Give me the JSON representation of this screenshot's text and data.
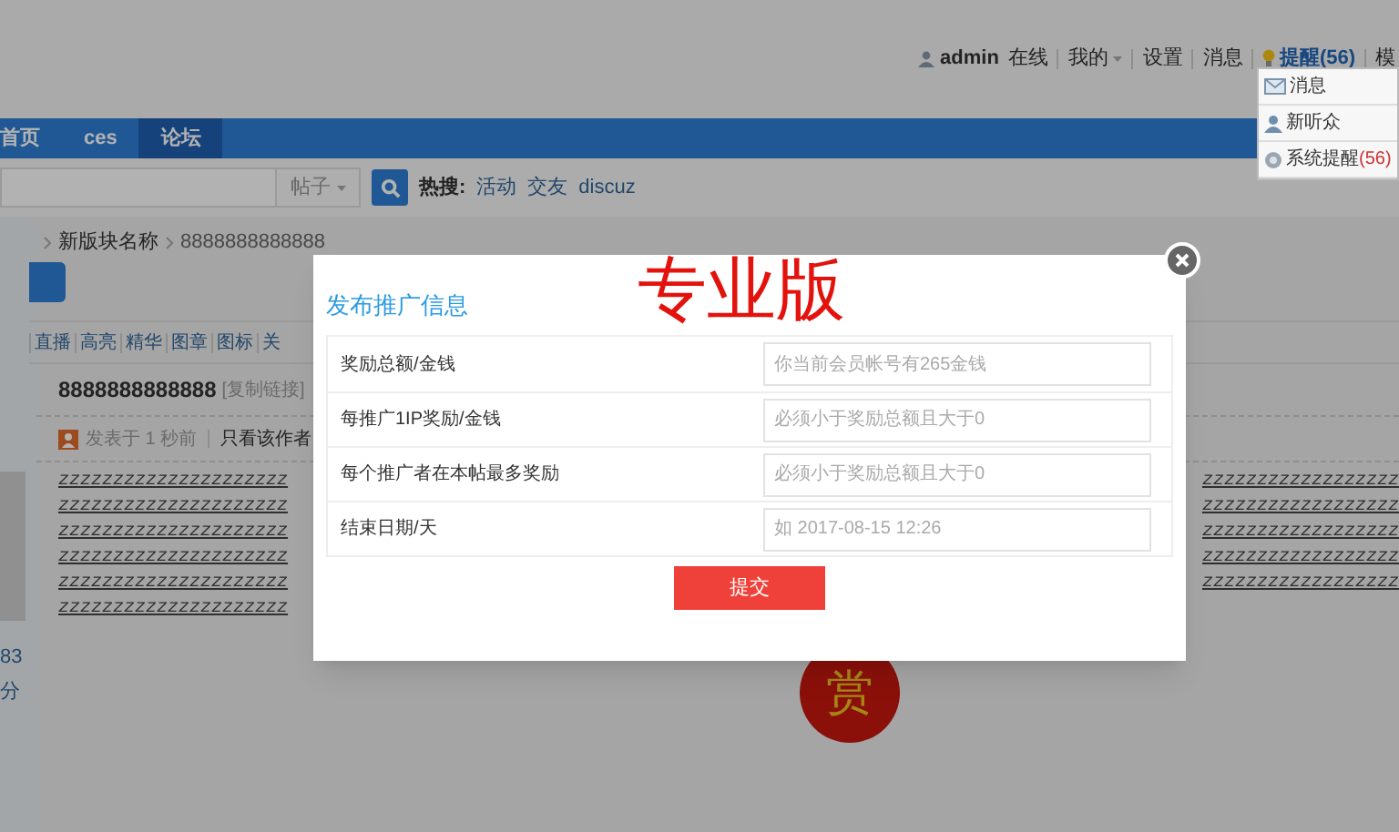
{
  "user_bar": {
    "username": "admin",
    "status": "在线",
    "links": [
      {
        "label": "我的",
        "kind": "menu"
      },
      {
        "label": "设置",
        "kind": "plain"
      },
      {
        "label": "消息",
        "kind": "plain"
      },
      {
        "label": "提醒(56)",
        "kind": "alert"
      },
      {
        "label": "模",
        "kind": "plain"
      }
    ]
  },
  "notify_menu": [
    {
      "label": "消息",
      "kind": "mail"
    },
    {
      "label": "新听众",
      "kind": "user"
    },
    {
      "label": "系统提醒",
      "count": "(56)",
      "kind": "system"
    }
  ],
  "nav": [
    {
      "label": "首页",
      "selected": false
    },
    {
      "label": "ces",
      "selected": false
    },
    {
      "label": "论坛",
      "selected": true
    }
  ],
  "search": {
    "scope": "帖子",
    "hot_label": "热搜:",
    "hot": [
      "活动",
      "交友",
      "discuz"
    ]
  },
  "breadcrumb": [
    "新版块名称",
    "8888888888888"
  ],
  "filters": [
    "直播",
    "高亮",
    "精华",
    "图章",
    "图标",
    "关"
  ],
  "post": {
    "title": "8888888888888",
    "copy_link": "[复制链接]",
    "meta": "发表于 1 秒前",
    "author_only": "只看该作者",
    "author_stats": [
      "83",
      "分"
    ],
    "reward": "赏",
    "lines_left": [
      "zzzzzzzzzzzzzzzzzzzzz",
      "zzzzzzzzzzzzzzzzzzzzz",
      "zzzzzzzzzzzzzzzzzzzzz",
      "zzzzzzzzzzzzzzzzzzzzz",
      "zzzzzzzzzzzzzzzzzzzzz",
      "zzzzzzzzzzzzzzzzzzzzz"
    ],
    "lines_right": [
      "zzzzzzzzzzzzzzzzzz",
      "zzzzzzzzzzzzzzzzzz",
      "zzzzzzzzzzzzzzzzzz",
      "zzzzzzzzzzzzzzzzzz",
      "zzzzzzzzzzzzzzzzzz"
    ]
  },
  "modal": {
    "badge": "专业版",
    "title": "发布推广信息",
    "submit": "提交",
    "fields": [
      {
        "label": "奖励总额/金钱",
        "placeholder": "你当前会员帐号有265金钱"
      },
      {
        "label": "每推广1IP奖励/金钱",
        "placeholder": "必须小于奖励总额且大于0"
      },
      {
        "label": "每个推广者在本帖最多奖励",
        "placeholder": "必须小于奖励总额且大于0"
      },
      {
        "label": "结束日期/天",
        "placeholder": "如 2017-08-15 12:26"
      }
    ]
  }
}
